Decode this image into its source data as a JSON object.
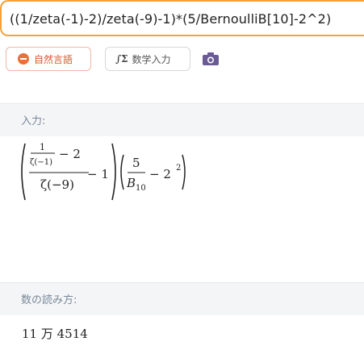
{
  "query": {
    "text": "((1/zeta(-1)-2)/zeta(-9)-1)*(5/BernoulliB[10]-2^2)"
  },
  "mode_buttons": {
    "natural_language": "自然言語",
    "math_input": "数学入力",
    "math_icon": "sigma-pi-icon",
    "camera_icon": "camera-icon"
  },
  "colors": {
    "accent_orange": "#f3a23b",
    "natural_button_text": "#d55a2e",
    "camera": "#6b5b95",
    "section_label": "#7a8a99"
  },
  "input_section": {
    "label": "入力:",
    "formula": {
      "one": "1",
      "zeta_minus1": "ζ(−1)",
      "minus_two": "− 2",
      "zeta_minus9": "ζ(−9)",
      "minus_one": "− 1",
      "five": "5",
      "bernoulli_B": "B",
      "bernoulli_sub": "10",
      "minus": "− 2",
      "exp": "2"
    }
  },
  "reading_section": {
    "label": "数の読み方:",
    "value": "11 万 4514"
  }
}
